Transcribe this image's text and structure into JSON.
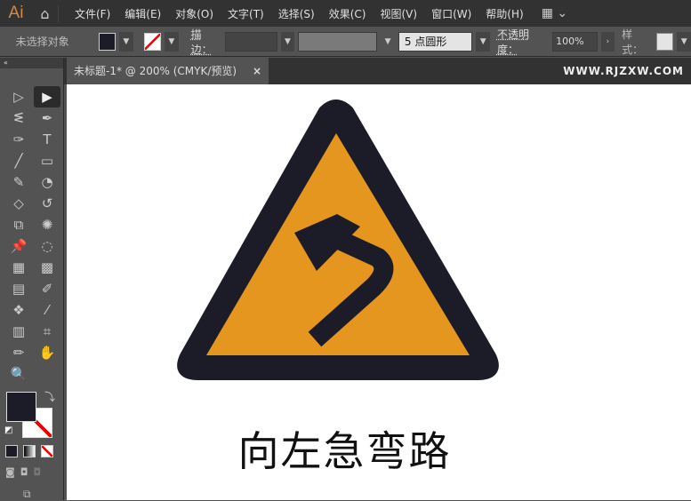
{
  "app": {
    "logo": "Ai",
    "home_icon": "⌂"
  },
  "menu": [
    "文件(F)",
    "编辑(E)",
    "对象(O)",
    "文字(T)",
    "选择(S)",
    "效果(C)",
    "视图(V)",
    "窗口(W)",
    "帮助(H)"
  ],
  "control": {
    "selection": "未选择对象",
    "stroke_label": "描边：",
    "brush": "5 点圆形",
    "opacity_label": "不透明度：",
    "opacity": "100%",
    "style_label": "样式："
  },
  "document": {
    "tab": "未标题-1* @ 200% (CMYK/预览)",
    "close": "×",
    "watermark": "WWW.RJZXW.COM"
  },
  "artwork": {
    "caption": "向左急弯路",
    "colors": {
      "dark": "#1b1c27",
      "orange": "#e5961f"
    }
  },
  "tools": [
    "▷",
    "▶",
    "ᓬ",
    "✒",
    "✑",
    "T",
    "╱",
    "▭",
    "✎",
    "◔",
    "◇",
    "↺",
    "⧉",
    "✺",
    "📌",
    "◌",
    "▦",
    "▩",
    "▤",
    "✐",
    "❖",
    "⁄",
    "▥",
    "⌗",
    "✏",
    "✋",
    "🔍",
    ""
  ]
}
